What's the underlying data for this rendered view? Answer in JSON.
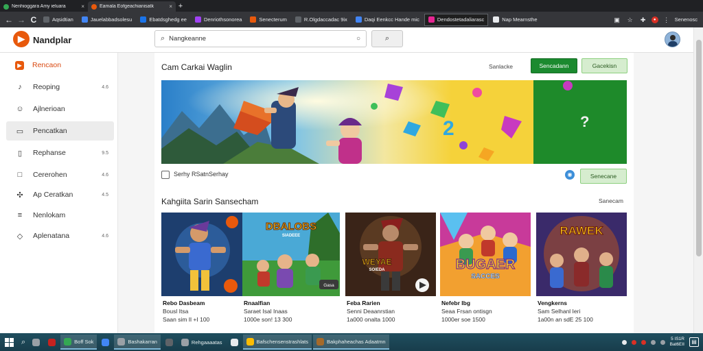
{
  "browser": {
    "tabs": [
      {
        "title": "Nenhioggara Amy ieluara",
        "icon_color": "#34a853",
        "active": false
      },
      {
        "title": "Eamala Eofgeachianisatk",
        "icon_color": "#e8590c",
        "active": true
      }
    ],
    "new_tab_label": "+",
    "nav": {
      "back": "←",
      "forward": "→",
      "reload": "C"
    },
    "bookmarks": [
      {
        "title": "Aqsidtian",
        "icon_color": "#5f6368",
        "selected": false
      },
      {
        "title": "Jauelabbadsolesu",
        "icon_color": "#4285f4",
        "selected": false
      },
      {
        "title": "Ebatdsghedg ee",
        "icon_color": "#1a73e8",
        "selected": false
      },
      {
        "title": "Denriothsonorea",
        "icon_color": "#a142f4",
        "selected": false
      },
      {
        "title": "Senecterum",
        "icon_color": "#e8590c",
        "selected": false
      },
      {
        "title": "R.Olgdaccadac 9ix",
        "icon_color": "#5f6368",
        "selected": false
      },
      {
        "title": "Daqi Eenkcc Hande mic",
        "icon_color": "#4285f4",
        "selected": false
      },
      {
        "title": "Dendostetadaliarasc",
        "icon_color": "#e52592",
        "selected": true
      },
      {
        "title": "Nap Mearnsthe",
        "icon_color": "#e8eaed",
        "selected": false
      }
    ],
    "profile_label": "Senenosc"
  },
  "site": {
    "brand": "Nandplar",
    "search": {
      "value": "Nangkeanne",
      "placeholder": "pnpalicarluien"
    },
    "sidebar": [
      {
        "label": "Rencaon",
        "icon": "play-store-icon",
        "count": "",
        "active": false,
        "highlight": true
      },
      {
        "label": "Reoping",
        "icon": "headphones-icon",
        "count": "4.6",
        "active": false,
        "highlight": false
      },
      {
        "label": "Ajlnerioan",
        "icon": "person-icon",
        "count": "",
        "active": false,
        "highlight": false
      },
      {
        "label": "Pencatkan",
        "icon": "app-window-icon",
        "count": "",
        "active": true,
        "highlight": false
      },
      {
        "label": "Rephanse",
        "icon": "bookmark-icon",
        "count": "9.5",
        "active": false,
        "highlight": false
      },
      {
        "label": "Cererohen",
        "icon": "folder-icon",
        "count": "4.6",
        "active": false,
        "highlight": false
      },
      {
        "label": "Ap Ceratkan",
        "icon": "gamepad-icon",
        "count": "4.5",
        "active": false,
        "highlight": false
      },
      {
        "label": "Nenlokam",
        "icon": "list-icon",
        "count": "",
        "active": false,
        "highlight": false
      },
      {
        "label": "Aplenatana",
        "icon": "tag-icon",
        "count": "4.6",
        "active": false,
        "highlight": false
      }
    ],
    "featured": {
      "title": "Cam Carkai Waglin",
      "link": "Sanlacke",
      "primary_button": "Sencadann",
      "secondary_button": "Gacekisn",
      "question_mark": "?",
      "checkbox_label": "Serhy RSatnSerhay",
      "checkbox_checked": false,
      "side_button": "Senecane"
    },
    "section2": {
      "title": "Kahgiita Sarin Sansecham",
      "link": "Sanecam"
    },
    "games": [
      {
        "art_text": "",
        "title": "Rebo Dasbeam",
        "line1": "Bousl Itsa",
        "line2": "Saan sim Il +I 100",
        "theme": "hero"
      },
      {
        "art_text": "DBALOBS",
        "title": "Rnaalfian",
        "line1": "Saraet Isal Inaas",
        "line2": "1000e son! 13 300",
        "theme": "forest"
      },
      {
        "art_text": "WEYAE",
        "title": "Feba Rarien",
        "line1": "Senni Deaanrstian",
        "line2": "1a000 onalta 1000",
        "theme": "ninja"
      },
      {
        "art_text": "BUGAER",
        "title": "Nefebr Ibg",
        "line1": "Seaa Frsan ontisgn",
        "line2": "1000er soe 1500",
        "theme": "party"
      },
      {
        "art_text": "RAWEK",
        "title": "Vengkerns",
        "line1": "Sam Selhanl Ieri",
        "line2": "1a00n an sdE 25 100",
        "theme": "squad"
      }
    ],
    "games_sub_labels": {
      "badge": "Gasa",
      "art_sub": "SIADEEE",
      "ninja_sub": "SOIEDA",
      "party_sub": "SACCES"
    }
  },
  "taskbar": {
    "items": [
      {
        "label": "",
        "icon_color": "#9aa0a6"
      },
      {
        "label": "",
        "icon_color": "#c5221f"
      },
      {
        "label": "Boff Sok",
        "icon_color": "#34a853",
        "boxed": true
      },
      {
        "label": "",
        "icon_color": "#4285f4"
      },
      {
        "label": "Bashakarran",
        "icon_color": "#9aa0a6",
        "boxed": true
      },
      {
        "label": "",
        "icon_color": "#5f6368"
      },
      {
        "label": "Rehgaaaatas",
        "icon_color": "#9aa0a6",
        "boxed": false
      },
      {
        "label": "",
        "icon_color": "#e8eaed"
      },
      {
        "label": "Bafschensenstrashlats",
        "icon_color": "#fbbc04",
        "boxed": true
      },
      {
        "label": "Bakphaheachas Adaatmn",
        "icon_color": "#a56a2a",
        "boxed": true
      }
    ],
    "clock": [
      "5 IS1R",
      "Bat6EII"
    ]
  },
  "colors": {
    "accent_orange": "#e8590c",
    "primary_green": "#1b8a2f",
    "light_green": "#d6edcf"
  }
}
